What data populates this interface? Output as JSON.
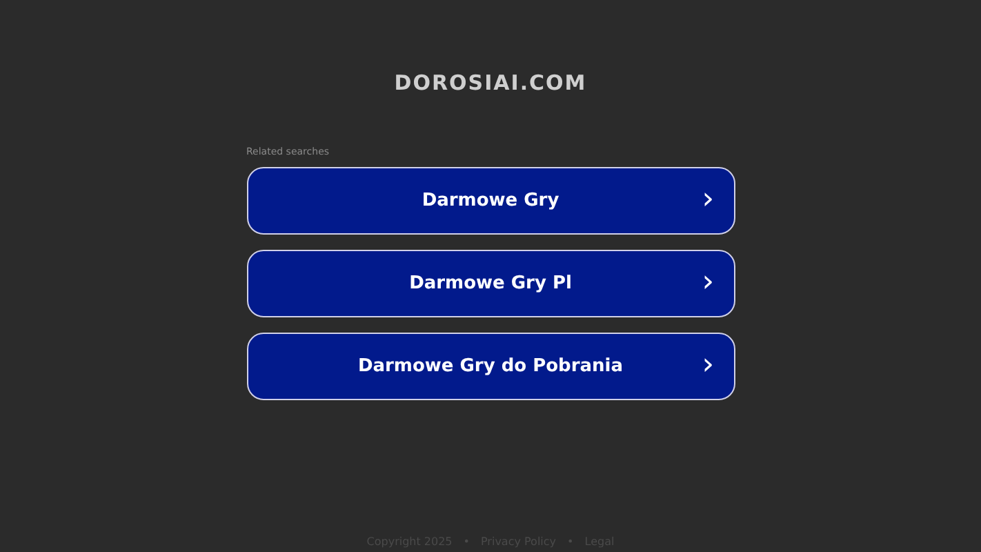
{
  "site_title": "DOROSIAI.COM",
  "related_label": "Related searches",
  "links": [
    {
      "label": "Darmowe Gry",
      "chevron": "›"
    },
    {
      "label": "Darmowe Gry Pl",
      "chevron": "›"
    },
    {
      "label": "Darmowe Gry do Pobrania",
      "chevron": "›"
    }
  ],
  "footer": {
    "copyright": "Copyright 2025",
    "links": [
      {
        "separator": "•",
        "label": "Privacy Policy"
      },
      {
        "separator": "•",
        "label": "Legal"
      }
    ]
  }
}
